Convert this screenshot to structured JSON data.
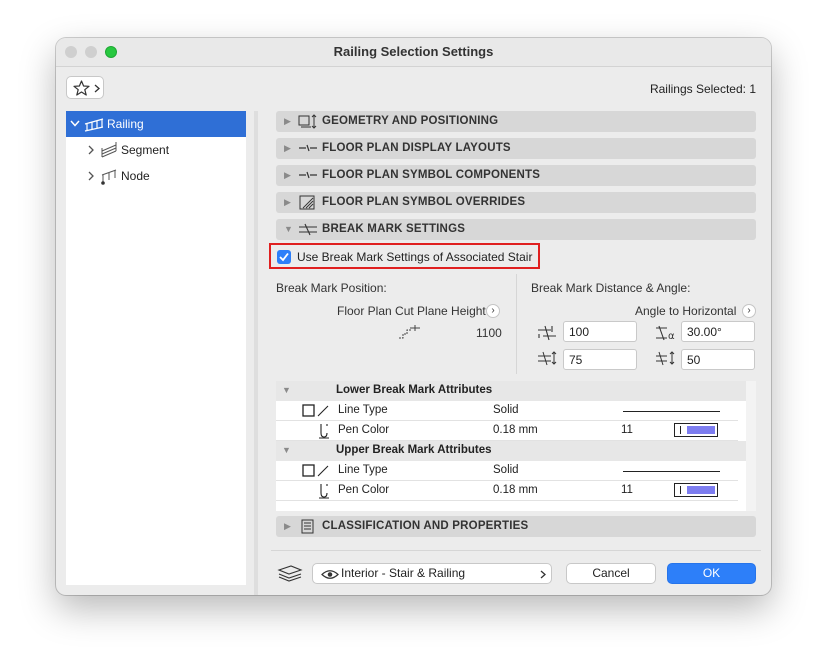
{
  "window": {
    "title": "Railing Selection Settings"
  },
  "toolbar": {
    "selection_info": "Railings Selected: 1",
    "favorites_icon": "star-icon"
  },
  "tree": {
    "root": {
      "label": "Railing",
      "icon": "railing-icon"
    },
    "children": [
      {
        "label": "Segment",
        "icon": "segment-icon"
      },
      {
        "label": "Node",
        "icon": "node-icon"
      }
    ]
  },
  "sections": {
    "geometry": "GEOMETRY AND POSITIONING",
    "floor_plan_display": "FLOOR PLAN DISPLAY LAYOUTS",
    "symbol_components": "FLOOR PLAN SYMBOL COMPONENTS",
    "symbol_overrides": "FLOOR PLAN SYMBOL OVERRIDES",
    "break_mark": "BREAK MARK SETTINGS",
    "classification": "CLASSIFICATION AND PROPERTIES"
  },
  "break_mark": {
    "use_associated_label": "Use Break Mark Settings of Associated Stair",
    "use_associated_checked": true,
    "position_label": "Break Mark Position:",
    "cut_plane_label": "Floor Plan Cut Plane Height",
    "cut_plane_value": "1100",
    "distance_angle_label": "Break Mark Distance & Angle:",
    "angle_ref_label": "Angle to Horizontal",
    "distance_value": "100",
    "angle_value": "30.00°",
    "offset_value": "75",
    "offset2_value": "50"
  },
  "attributes": {
    "lower": {
      "title": "Lower Break Mark Attributes",
      "line_type_label": "Line Type",
      "line_type_value": "Solid",
      "pen_color_label": "Pen Color",
      "pen_color_weight": "0.18 mm",
      "pen_color_index": "11"
    },
    "upper": {
      "title": "Upper Break Mark Attributes",
      "line_type_label": "Line Type",
      "line_type_value": "Solid",
      "pen_color_label": "Pen Color",
      "pen_color_weight": "0.18 mm",
      "pen_color_index": "11"
    },
    "pen_swatch_color": "#7d7df0"
  },
  "footer": {
    "view_selector": "Interior - Stair & Railing",
    "cancel_label": "Cancel",
    "ok_label": "OK"
  },
  "colors": {
    "accent": "#2f6fd6",
    "ok_button": "#2d7ff9",
    "highlight": "#e02020"
  }
}
